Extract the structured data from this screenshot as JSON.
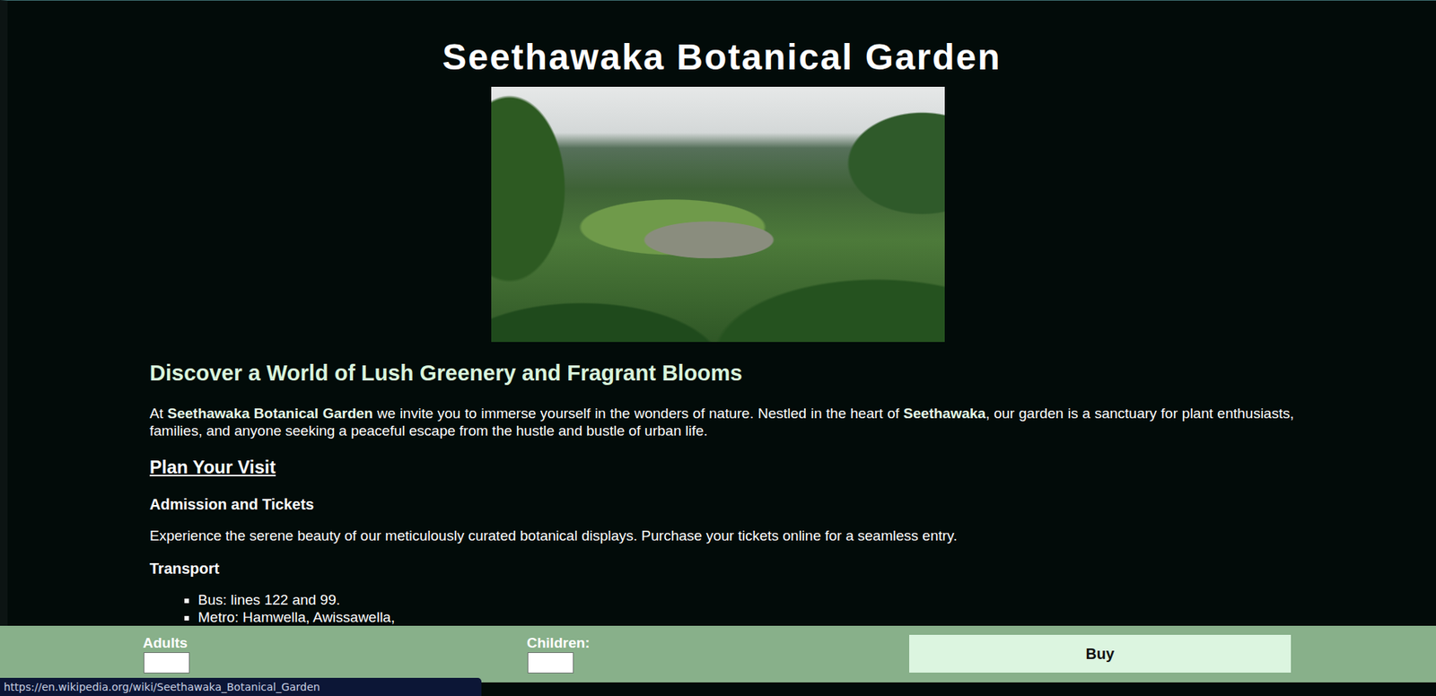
{
  "page": {
    "title": "Seethawaka Botanical Garden",
    "headline": "Discover a World of Lush Greenery and Fragrant Blooms",
    "intro": [
      {
        "text": "At ",
        "bold": false
      },
      {
        "text": "Seethawaka Botanical Garden",
        "bold": true
      },
      {
        "text": " we invite you to immerse yourself in the wonders of nature. Nestled in the heart of ",
        "bold": false
      },
      {
        "text": "Seethawaka",
        "bold": true
      },
      {
        "text": ", our garden is a sanctuary for plant enthusiasts, families, and anyone seeking a peaceful escape from the hustle and bustle of urban life.",
        "bold": false
      }
    ],
    "plan_heading": "Plan Your Visit",
    "sections": [
      {
        "heading": "Admission and Tickets",
        "kind": "text",
        "text": "Experience the serene beauty of our meticulously curated botanical displays. Purchase your tickets online for a seamless entry."
      },
      {
        "heading": "Transport",
        "kind": "list",
        "items": [
          "Bus: lines 122 and 99.",
          "Metro: Hamwella, Awissawella,"
        ]
      }
    ]
  },
  "ticket_bar": {
    "fields": [
      {
        "label": "Adults",
        "value": ""
      },
      {
        "label": "Children:",
        "value": ""
      }
    ],
    "button": "Buy"
  },
  "status_url": "https://en.wikipedia.org/wiki/Seethawaka_Botanical_Garden"
}
